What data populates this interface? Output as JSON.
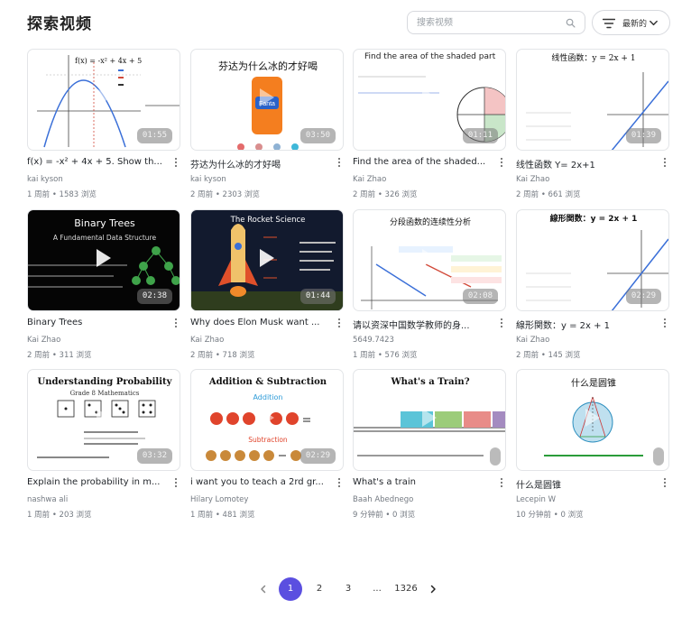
{
  "header": {
    "title": "探索视频",
    "search_placeholder": "搜索视频",
    "sort_label": "最新的"
  },
  "videos": [
    {
      "title": "f(x) = -x² + 4x + 5. Show th...",
      "author": "kai kyson",
      "age": "1 周前",
      "views": "1583 浏览",
      "duration": "01:55",
      "thumb_text": "f(x) = -x² + 4x + 5"
    },
    {
      "title": "芬达为什么冰的才好喝",
      "author": "kai kyson",
      "age": "2 周前",
      "views": "2303 浏览",
      "duration": "03:50",
      "thumb_text": "芬达为什么冰的才好喝"
    },
    {
      "title": "Find the area of the shaded...",
      "author": "Kai Zhao",
      "age": "2 周前",
      "views": "326 浏览",
      "duration": "01:11",
      "thumb_text": "Find the area of the shaded part"
    },
    {
      "title": "线性函数 Y= 2x+1",
      "author": "Kai Zhao",
      "age": "2 周前",
      "views": "661 浏览",
      "duration": "01:39",
      "thumb_text": "线性函数：y = 2x + 1"
    },
    {
      "title": "Binary Trees",
      "author": "Kai Zhao",
      "age": "2 周前",
      "views": "311 浏览",
      "duration": "02:38",
      "thumb_text": "Binary Trees",
      "thumb_sub": "A Fundamental Data Structure"
    },
    {
      "title": "Why does Elon Musk want ...",
      "author": "Kai Zhao",
      "age": "2 周前",
      "views": "718 浏览",
      "duration": "01:44",
      "thumb_text": "The Rocket Science"
    },
    {
      "title": "请以资深中国数学教师的身...",
      "author": "5649.7423",
      "age": "1 周前",
      "views": "576 浏览",
      "duration": "02:08",
      "thumb_text": "分段函数的连续性分析"
    },
    {
      "title": "線形関数：y = 2x + 1",
      "author": "Kai Zhao",
      "age": "2 周前",
      "views": "145 浏览",
      "duration": "02:29",
      "thumb_text": "線形関数：y = 2x + 1"
    },
    {
      "title": "Explain the probability in m...",
      "author": "nashwa ali",
      "age": "1 周前",
      "views": "203 浏览",
      "duration": "03:32",
      "thumb_text": "Understanding Probability",
      "thumb_sub": "Grade 8 Mathematics"
    },
    {
      "title": "i want you to teach a 2rd gr...",
      "author": "Hilary Lomotey",
      "age": "1 周前",
      "views": "481 浏览",
      "duration": "02:29",
      "thumb_text": "Addition & Subtraction",
      "thumb_sub": "Addition",
      "thumb_sub2": "Subtraction"
    },
    {
      "title": "What's a train",
      "author": "Baah Abednego",
      "age": "9 分钟前",
      "views": "0 浏览",
      "duration": "",
      "thumb_text": "What's a Train?"
    },
    {
      "title": "什么是圆锥",
      "author": "Lecepin W",
      "age": "10 分钟前",
      "views": "0 浏览",
      "duration": "",
      "thumb_text": "什么是圆锥"
    }
  ],
  "pagination": {
    "pages": [
      "1",
      "2",
      "3",
      "...",
      "1326"
    ],
    "current": "1"
  },
  "colors": {
    "accent": "#5b4fe0",
    "muted_text": "#747a82"
  }
}
